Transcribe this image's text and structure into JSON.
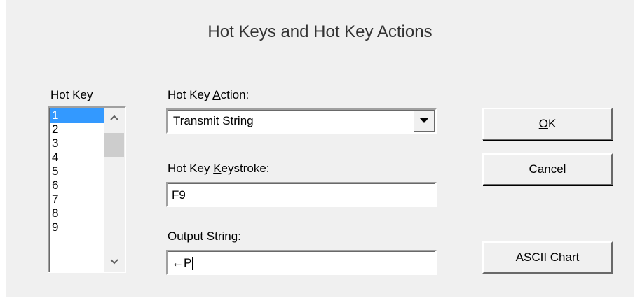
{
  "dialog": {
    "title": "Hot Keys and Hot Key Actions"
  },
  "hotkey_list": {
    "label": "Hot Key",
    "items": [
      "1",
      "2",
      "3",
      "4",
      "5",
      "6",
      "7",
      "8",
      "9"
    ],
    "selected": "1"
  },
  "action": {
    "label_pre": "Hot Key ",
    "label_accel": "A",
    "label_post": "ction:",
    "value": "Transmit String"
  },
  "keystroke": {
    "label_pre": "Hot Key ",
    "label_accel": "K",
    "label_post": "eystroke:",
    "value": "F9"
  },
  "output": {
    "label_accel": "O",
    "label_post": "utput String:",
    "value": "←P"
  },
  "buttons": {
    "ok_accel": "O",
    "ok_post": "K",
    "cancel_accel": "C",
    "cancel_post": "ancel",
    "ascii_accel": "A",
    "ascii_post": "SCII Chart"
  },
  "colors": {
    "selection": "#3399ff",
    "dialog_bg": "#f0f0f0"
  }
}
